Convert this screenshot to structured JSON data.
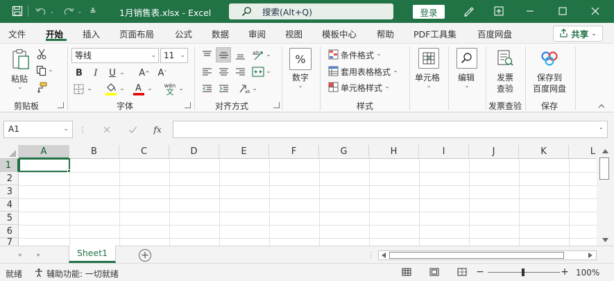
{
  "titlebar": {
    "doc_title": "1月销售表.xlsx  -  Excel",
    "search_label": "搜索(Alt+Q)",
    "login_label": "登录",
    "bg_color": "#217346"
  },
  "tabs": [
    {
      "label": "文件"
    },
    {
      "label": "开始"
    },
    {
      "label": "插入"
    },
    {
      "label": "页面布局"
    },
    {
      "label": "公式"
    },
    {
      "label": "数据"
    },
    {
      "label": "审阅"
    },
    {
      "label": "视图"
    },
    {
      "label": "模板中心"
    },
    {
      "label": "帮助"
    },
    {
      "label": "PDF工具集"
    },
    {
      "label": "百度网盘"
    }
  ],
  "share_label": "共享",
  "ribbon": {
    "clipboard": {
      "paste_label": "粘贴",
      "group_label": "剪贴板"
    },
    "font": {
      "font_name": "等线",
      "font_size": "11",
      "group_label": "字体",
      "bold": "B",
      "italic": "I",
      "underline": "U",
      "grow": "A^",
      "shrink": "Aˇ",
      "fill_letter": "A",
      "phonetic": "wén"
    },
    "alignment": {
      "group_label": "对齐方式"
    },
    "number": {
      "label": "数字",
      "symbol": "%"
    },
    "styles": {
      "cond_format": "条件格式",
      "table_format": "套用表格格式",
      "cell_style": "单元格样式",
      "group_label": "样式"
    },
    "cells": {
      "label": "单元格"
    },
    "editing": {
      "label": "编辑"
    },
    "invoice": {
      "label_line1": "发票",
      "label_line2": "查验",
      "group_label": "发票查验"
    },
    "save": {
      "label_line1": "保存到",
      "label_line2": "百度网盘",
      "group_label": "保存"
    }
  },
  "formula_bar": {
    "name_box": "A1",
    "fx": "fx",
    "formula": ""
  },
  "grid": {
    "columns": [
      "A",
      "B",
      "C",
      "D",
      "E",
      "F",
      "G",
      "H",
      "I",
      "J",
      "K",
      "L"
    ],
    "rows": [
      "1",
      "2",
      "3",
      "4",
      "5",
      "6",
      "7"
    ],
    "active_cell": "A1"
  },
  "sheets": {
    "tabs": [
      "Sheet1"
    ],
    "add_symbol": "+"
  },
  "status": {
    "ready": "就绪",
    "accessibility": "辅助功能: 一切就绪",
    "zoom": "100%"
  },
  "colors": {
    "accent": "#217346"
  }
}
